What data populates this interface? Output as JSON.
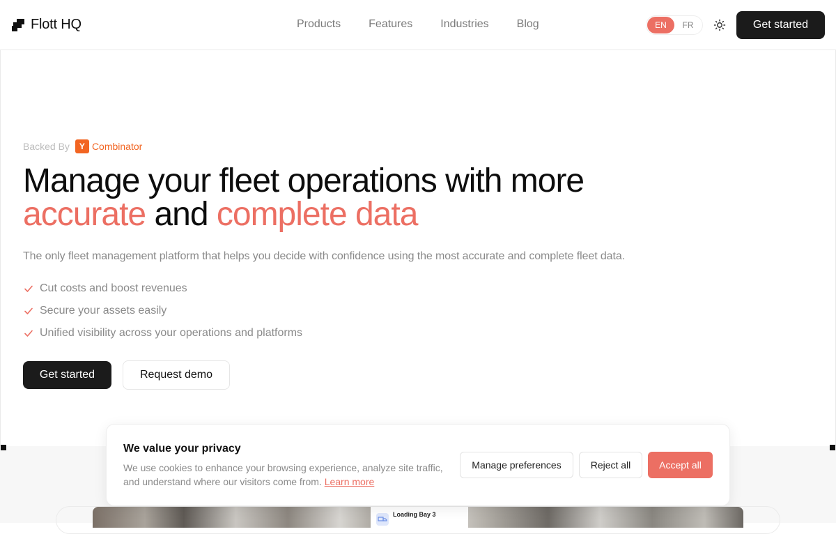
{
  "brand": {
    "name": "Flott HQ"
  },
  "nav": {
    "items": [
      "Products",
      "Features",
      "Industries",
      "Blog"
    ]
  },
  "language": {
    "options": [
      "EN",
      "FR"
    ],
    "selected": "EN"
  },
  "header": {
    "cta_label": "Get started",
    "theme_icon": "sun-icon"
  },
  "hero": {
    "backed_by_label": "Backed By",
    "backer_logo_letter": "Y",
    "backer_name": "Combinator",
    "headline_line1": "Manage your fleet operations with more",
    "headline_accent1": "accurate",
    "headline_connector": " and ",
    "headline_accent2": "complete data",
    "subtitle": "The only fleet management platform that helps you decide with confidence using the most accurate and complete fleet data.",
    "benefits": [
      "Cut costs and boost revenues",
      "Secure your assets easily",
      "Unified visibility across your operations and platforms"
    ],
    "primary_cta": "Get started",
    "secondary_cta": "Request demo"
  },
  "preview": {
    "card_title": "Loading Bay 3"
  },
  "cookie": {
    "title": "We value your privacy",
    "text": "We use cookies to enhance your browsing experience, analyze site traffic, and understand where our visitors come from.",
    "learn_more": "Learn more",
    "manage_label": "Manage preferences",
    "reject_label": "Reject all",
    "accept_label": "Accept all"
  },
  "colors": {
    "accent": "#ec6f63",
    "dark": "#1b1b1b",
    "yc_orange": "#f26522"
  }
}
